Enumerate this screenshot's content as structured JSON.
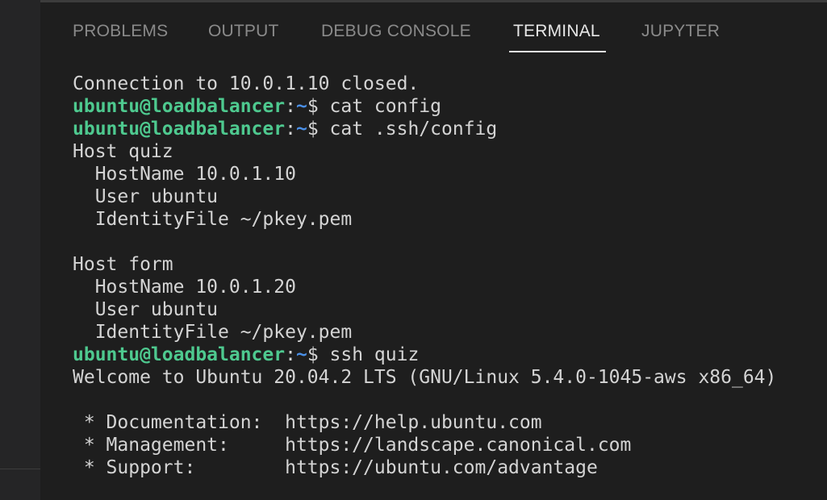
{
  "tabs": [
    {
      "label": "PROBLEMS",
      "active": false
    },
    {
      "label": "OUTPUT",
      "active": false
    },
    {
      "label": "DEBUG CONSOLE",
      "active": false
    },
    {
      "label": "TERMINAL",
      "active": true
    },
    {
      "label": "JUPYTER",
      "active": false
    }
  ],
  "colors": {
    "background": "#1e1e1e",
    "prompt_user": "#4ec98f",
    "prompt_path": "#4a8fe6",
    "text": "#d4d4d4",
    "active_tab": "#e7e7e7",
    "inactive_tab": "#8a8a8a"
  },
  "terminal": {
    "lines": [
      {
        "type": "output",
        "text": "Connection to 10.0.1.10 closed."
      },
      {
        "type": "prompt",
        "user": "ubuntu@loadbalancer",
        "sep": ":",
        "path": "~",
        "symbol": "$ ",
        "command": "cat config"
      },
      {
        "type": "prompt",
        "user": "ubuntu@loadbalancer",
        "sep": ":",
        "path": "~",
        "symbol": "$ ",
        "command": "cat .ssh/config"
      },
      {
        "type": "output",
        "text": "Host quiz"
      },
      {
        "type": "output",
        "text": "  HostName 10.0.1.10"
      },
      {
        "type": "output",
        "text": "  User ubuntu"
      },
      {
        "type": "output",
        "text": "  IdentityFile ~/pkey.pem"
      },
      {
        "type": "output",
        "text": ""
      },
      {
        "type": "output",
        "text": "Host form"
      },
      {
        "type": "output",
        "text": "  HostName 10.0.1.20"
      },
      {
        "type": "output",
        "text": "  User ubuntu"
      },
      {
        "type": "output",
        "text": "  IdentityFile ~/pkey.pem"
      },
      {
        "type": "prompt",
        "user": "ubuntu@loadbalancer",
        "sep": ":",
        "path": "~",
        "symbol": "$ ",
        "command": "ssh quiz"
      },
      {
        "type": "output",
        "text": "Welcome to Ubuntu 20.04.2 LTS (GNU/Linux 5.4.0-1045-aws x86_64)"
      },
      {
        "type": "output",
        "text": ""
      },
      {
        "type": "output",
        "text": " * Documentation:  https://help.ubuntu.com"
      },
      {
        "type": "output",
        "text": " * Management:     https://landscape.canonical.com"
      },
      {
        "type": "output",
        "text": " * Support:        https://ubuntu.com/advantage"
      }
    ]
  }
}
